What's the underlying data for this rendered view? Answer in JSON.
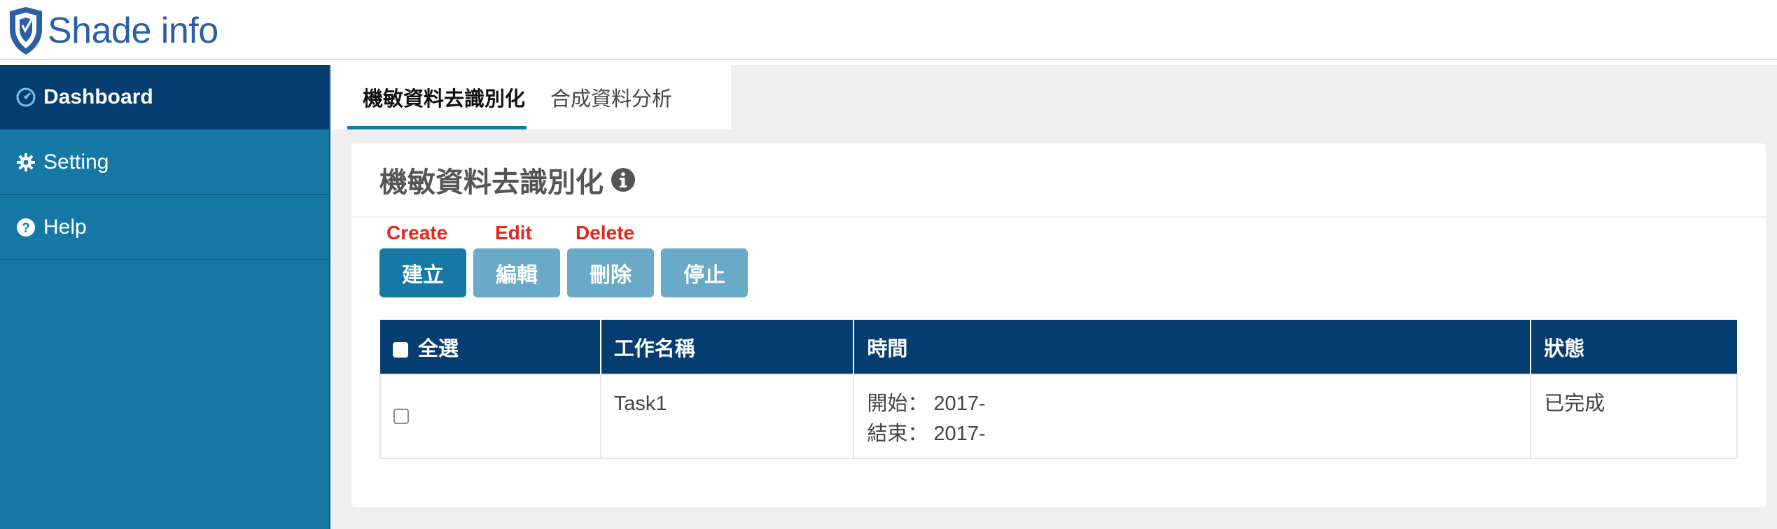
{
  "header": {
    "logo_text": "Shade info",
    "brand_color": "#2a5fa8"
  },
  "sidebar": {
    "items": [
      {
        "label": "Dashboard",
        "icon": "dashboard-icon",
        "active": true
      },
      {
        "label": "Setting",
        "icon": "gear-icon",
        "active": false
      },
      {
        "label": "Help",
        "icon": "question-circle-icon",
        "active": false
      }
    ],
    "bg_color": "#1679a5",
    "active_color": "#053d70"
  },
  "tabs": [
    {
      "label": "機敏資料去識別化",
      "active": true
    },
    {
      "label": "合成資料分析",
      "active": false
    }
  ],
  "card": {
    "title": "機敏資料去識別化",
    "annotations": {
      "create": "Create",
      "edit": "Edit",
      "delete": "Delete"
    },
    "buttons": {
      "create": "建立",
      "edit": "編輯",
      "delete": "刪除",
      "stop": "停止"
    },
    "table": {
      "headers": {
        "select_all": "全選",
        "task_name": "工作名稱",
        "time": "時間",
        "status": "狀態"
      },
      "rows": [
        {
          "task_name": "Task1",
          "start": "開始： 2017-",
          "end": "結束： 2017-",
          "status": "已完成"
        }
      ]
    }
  }
}
